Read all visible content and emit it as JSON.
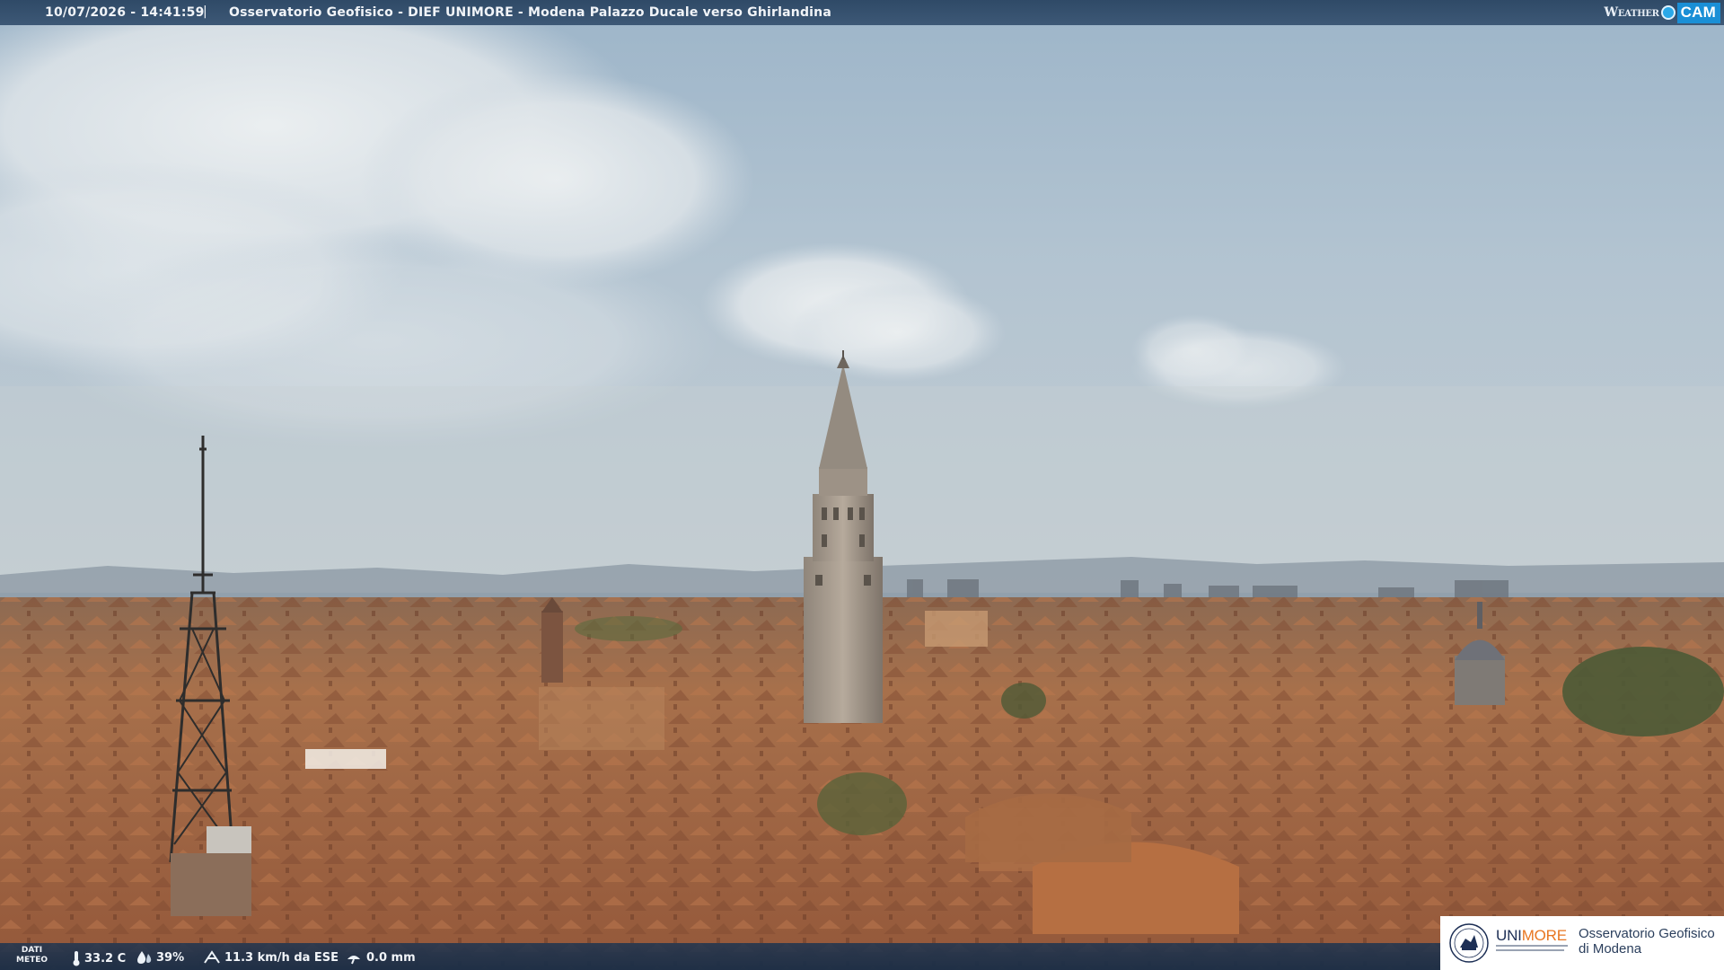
{
  "overlay": {
    "datetime": "10/07/2026 - 14:41:59",
    "separator": "|",
    "title": "Osservatorio Geofisico - DIEF UNIMORE - Modena Palazzo Ducale verso Ghirlandina"
  },
  "brand": {
    "weather": "Weather",
    "cam": "CAM"
  },
  "meteo": {
    "label_line1": "DATI",
    "label_line2": "METEO",
    "temperature": "33.2 C",
    "humidity": "39%",
    "wind": "11.3 km/h da ESE",
    "rain": "0.0 mm",
    "icons": [
      "thermometer-icon",
      "humidity-drop-icon",
      "wind-icon",
      "rain-icon"
    ]
  },
  "logo": {
    "unimore_a": "UNI",
    "unimore_b": "MORE",
    "observatory_line1": "Osservatorio Geofisico",
    "observatory_line2": "di Modena",
    "colors": {
      "navy": "#1d2f55",
      "orange": "#e87722"
    }
  },
  "scene": {
    "description_icons": [
      "ghirlandina-tower",
      "radio-antenna-tower",
      "church-dome",
      "rooftops",
      "cumulus-clouds"
    ]
  }
}
